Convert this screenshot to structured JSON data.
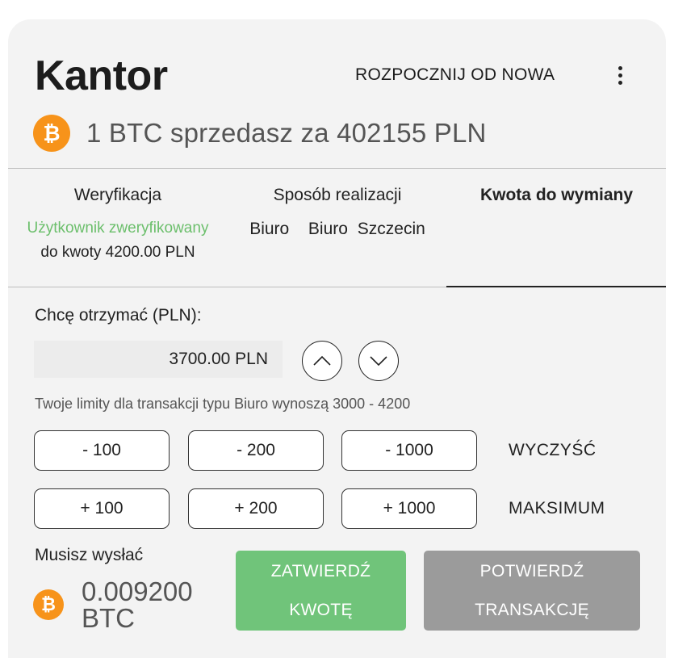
{
  "header": {
    "title": "Kantor",
    "restart_label": "ROZPOCZNIJ OD NOWA",
    "menu_icon": "more-vertical-icon"
  },
  "rate": {
    "icon": "bitcoin-icon",
    "icon_symbol": "₿",
    "text": "1 BTC sprzedasz za 402155 PLN"
  },
  "tabs": [
    {
      "title": "Weryfikacja",
      "status": "Użytkownik zweryfikowany",
      "detail": "do kwoty 4200.00 PLN"
    },
    {
      "title": "Sposób realizacji",
      "detail": "Biuro  Biuro Szczecin"
    },
    {
      "title": "Kwota do wymiany",
      "active": true
    }
  ],
  "receive": {
    "label": "Chcę otrzymać (PLN):",
    "value": "3700.00 PLN"
  },
  "limits_text": "Twoje limity dla transakcji typu Biuro wynoszą 3000 - 4200",
  "minus_buttons": [
    "- 100",
    "- 200",
    "- 1000"
  ],
  "plus_buttons": [
    "+ 100",
    "+ 200",
    "+ 1000"
  ],
  "clear_label": "WYCZYŚĆ",
  "max_label": "MAKSIMUM",
  "send": {
    "label": "Musisz wysłać",
    "amount": "0.009200",
    "currency": "BTC"
  },
  "actions": {
    "confirm_amount_line1": "ZATWIERDŹ",
    "confirm_amount_line2": "KWOTĘ",
    "confirm_tx_line1": "POTWIERDŹ",
    "confirm_tx_line2": "TRANSAKCJĘ"
  },
  "colors": {
    "bitcoin": "#f7931a",
    "verified": "#6cbf6c",
    "confirm_amount_bg": "#70c47a",
    "confirm_tx_bg": "#9b9b9b",
    "card_bg": "#f3f3f3"
  }
}
